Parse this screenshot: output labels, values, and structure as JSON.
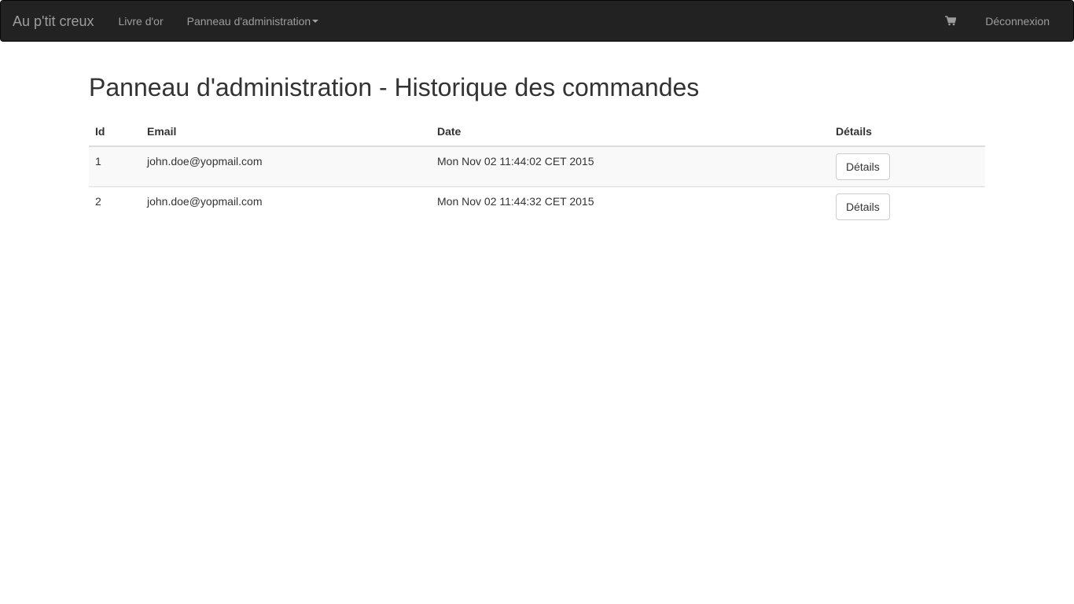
{
  "navbar": {
    "brand": "Au p'tit creux",
    "links": [
      {
        "label": "Livre d'or"
      },
      {
        "label": "Panneau d'administration"
      }
    ],
    "cart_icon": "shopping-cart-icon",
    "logout_label": "Déconnexion"
  },
  "page": {
    "title": "Panneau d'administration - Historique des commandes"
  },
  "table": {
    "headers": [
      "Id",
      "Email",
      "Date",
      "Détails"
    ],
    "rows": [
      {
        "id": "1",
        "email": "john.doe@yopmail.com",
        "date": "Mon Nov 02 11:44:02 CET 2015",
        "details_label": "Détails"
      },
      {
        "id": "2",
        "email": "john.doe@yopmail.com",
        "date": "Mon Nov 02 11:44:32 CET 2015",
        "details_label": "Détails"
      }
    ]
  },
  "colors": {
    "navbar_bg": "#222222",
    "navbar_text": "#9d9d9d",
    "striped_row": "#f9f9f9"
  }
}
